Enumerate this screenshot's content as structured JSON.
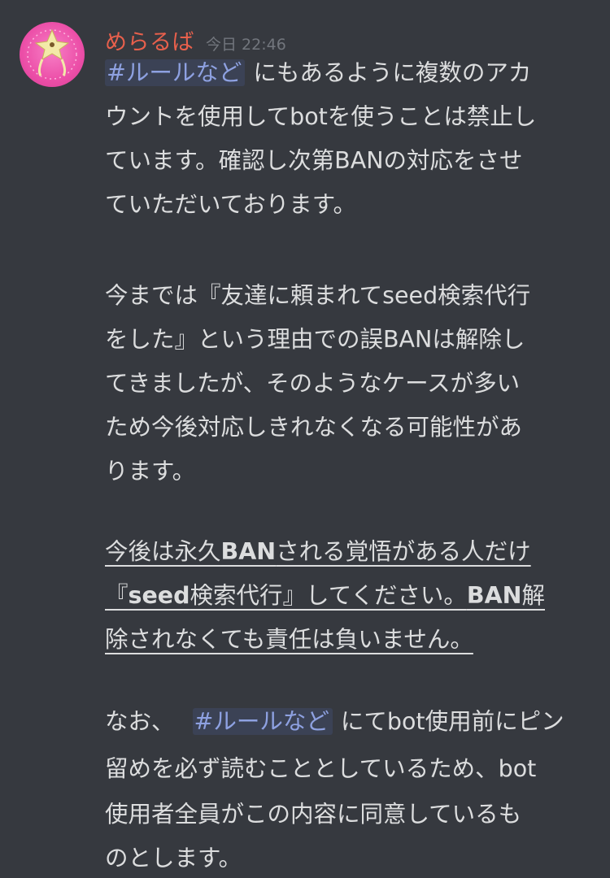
{
  "message": {
    "username": "めらるば",
    "timestamp": "今日 22:46",
    "paragraph1": {
      "mention": "#ルールなど",
      "line1_rest": "にもあるように複数のアカ",
      "line2": "ウントを使用してbotを使うことは禁止し",
      "line3": "ています。確認し次第BANの対応をさせ",
      "line4": "ていただいております。"
    },
    "paragraph2": {
      "line1": "今までは『友達に頼まれてseed検索代行",
      "line2": "をした』という理由での誤BANは解除し",
      "line3": "てきましたが、そのようなケースが多い",
      "line4": "ため今後対応しきれなくなる可能性があ",
      "line5": "ります。"
    },
    "paragraph3": {
      "line1_a": "今後は永久",
      "line1_b": "BAN",
      "line1_c": "される覚悟がある人だけ",
      "line2_a": "『",
      "line2_b": "seed",
      "line2_c": "検索代行』してください。",
      "line2_d": "BAN",
      "line2_e": "解",
      "line3": "除されなくても責任は負いません。"
    },
    "paragraph4": {
      "line1_a": "なお、",
      "mention": "#ルールなど",
      "line1_b": "にてbot使用前にピン",
      "line2": "留めを必ず読むこととしているため、bot",
      "line3": "使用者全員がこの内容に同意しているも",
      "line4": "のとします。"
    }
  },
  "colors": {
    "background": "#36393f",
    "username": "#e8604c",
    "timestamp": "#72767d",
    "text": "#dcddde",
    "mention_text": "#8ea1e1",
    "mention_bg": "#3b4255",
    "avatar": "#ec4fa8"
  }
}
